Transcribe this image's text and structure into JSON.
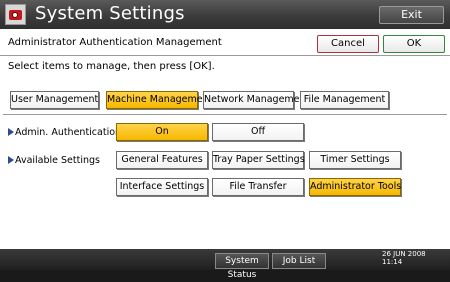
{
  "window": {
    "title": "System Settings",
    "exit_label": "Exit"
  },
  "header": {
    "title": "Administrator Authentication Management",
    "cancel_label": "Cancel",
    "ok_label": "OK"
  },
  "instruction": "Select items to manage, then press [OK].",
  "tabs": [
    {
      "label": "User Management",
      "selected": false
    },
    {
      "label": "Machine Management",
      "selected": true
    },
    {
      "label": "Network Management",
      "selected": false
    },
    {
      "label": "File Management",
      "selected": false
    }
  ],
  "admin_auth": {
    "label": "Admin. Authentication",
    "on_label": "On",
    "off_label": "Off",
    "selected": "On"
  },
  "available_settings": {
    "label": "Available Settings",
    "options": [
      {
        "label": "General Features",
        "selected": false
      },
      {
        "label": "Tray Paper Settings",
        "selected": false
      },
      {
        "label": "Timer Settings",
        "selected": false
      },
      {
        "label": "Interface Settings",
        "selected": false
      },
      {
        "label": "File Transfer",
        "selected": false
      },
      {
        "label": "Administrator Tools",
        "selected": true
      }
    ]
  },
  "statusbar": {
    "system_status_label": "System Status",
    "job_list_label": "Job List",
    "date": "26 JUN  2008",
    "time": "11:14"
  },
  "colors": {
    "selected": "#f6b800",
    "cancel_border": "#b03040",
    "ok_border": "#2e8a3a"
  }
}
